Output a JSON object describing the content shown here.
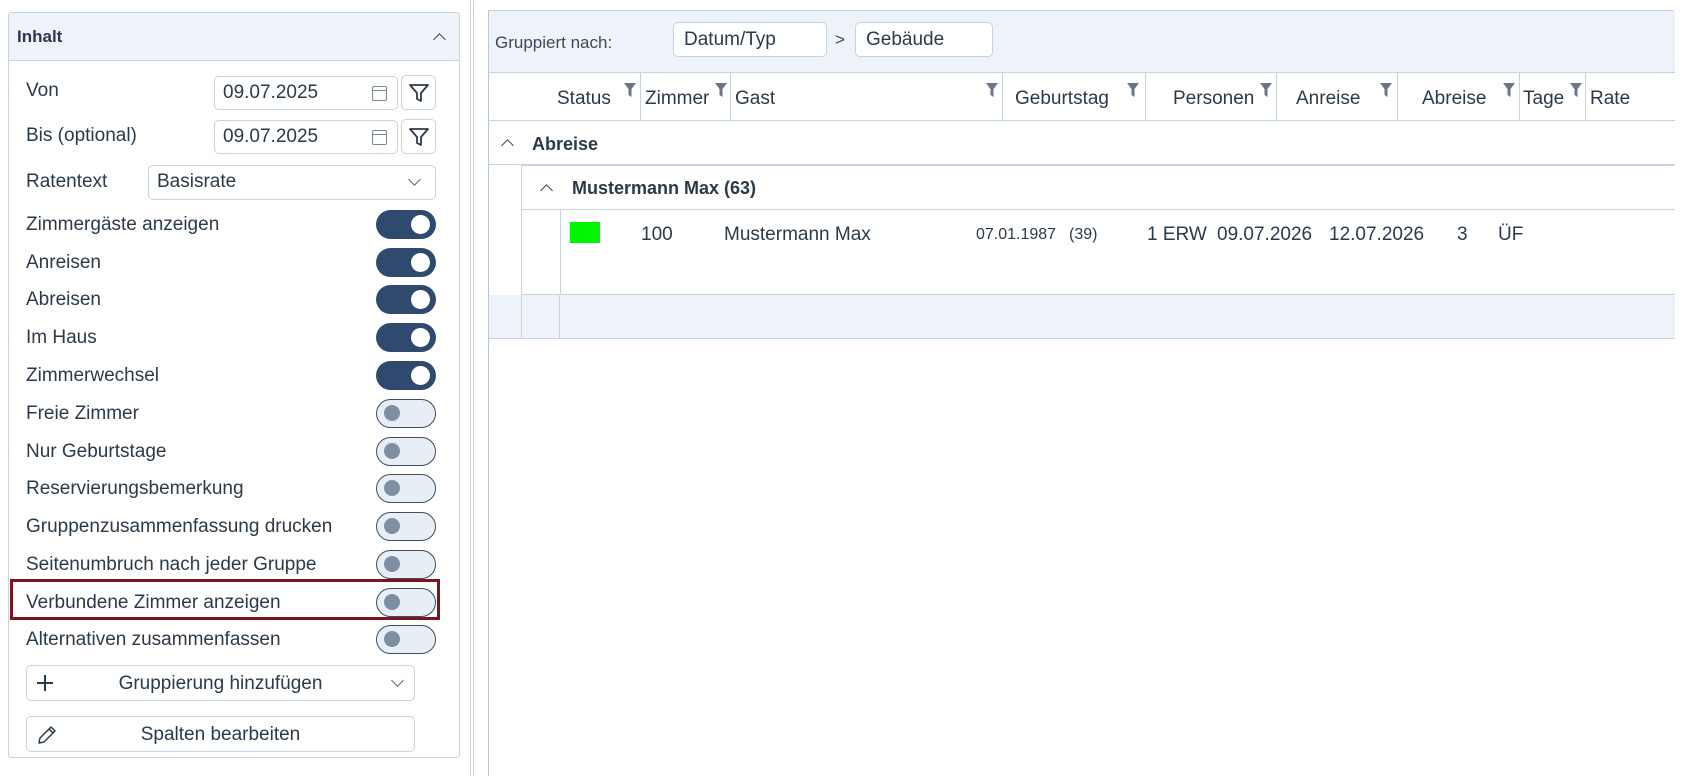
{
  "panel": {
    "title": "Inhalt",
    "von_label": "Von",
    "von_value": "09.07.2025",
    "bis_label": "Bis (optional)",
    "bis_value": "09.07.2025",
    "ratentext_label": "Ratentext",
    "ratentext_value": "Basisrate",
    "toggles": [
      {
        "label": "Zimmergäste anzeigen",
        "on": true
      },
      {
        "label": "Anreisen",
        "on": true
      },
      {
        "label": "Abreisen",
        "on": true
      },
      {
        "label": "Im Haus",
        "on": true
      },
      {
        "label": "Zimmerwechsel",
        "on": true
      },
      {
        "label": "Freie Zimmer",
        "on": false
      },
      {
        "label": "Nur Geburtstage",
        "on": false
      },
      {
        "label": "Reservierungsbemerkung",
        "on": false
      },
      {
        "label": "Gruppenzusammenfassung drucken",
        "on": false
      },
      {
        "label": "Seitenumbruch nach jeder Gruppe",
        "on": false
      },
      {
        "label": "Verbundene Zimmer anzeigen",
        "on": false
      },
      {
        "label": "Alternativen zusammenfassen",
        "on": false
      }
    ],
    "add_grouping_label": "Gruppierung hinzufügen",
    "edit_columns_label": "Spalten bearbeiten"
  },
  "grouping": {
    "label": "Gruppiert nach:",
    "chips": [
      "Datum/Typ",
      "Gebäude"
    ],
    "separator": ">"
  },
  "columns": [
    "Status",
    "Zimmer",
    "Gast",
    "Geburtstag",
    "Personen",
    "Anreise",
    "Abreise",
    "Tage",
    "Rate"
  ],
  "groups": {
    "level1_title": "Abreise",
    "level2_title": "Mustermann Max (63)"
  },
  "row": {
    "status_color": "#00f500",
    "zimmer": "100",
    "gast": "Mustermann Max",
    "geburtstag": "07.01.1987",
    "alter": "(39)",
    "personen": "1 ERW",
    "anreise": "09.07.2026",
    "abreise": "12.07.2026",
    "tage": "3",
    "rate": "ÜF"
  },
  "colors": {
    "accent": "#2f4a6e",
    "highlight": "#7b1520",
    "panel_bg": "#eef3f9",
    "border": "#c5d3e2"
  }
}
